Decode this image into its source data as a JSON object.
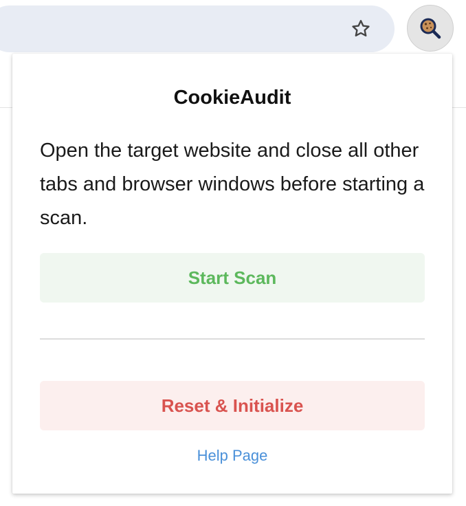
{
  "browser": {
    "bookmark_icon": "star-outline-icon",
    "extension_icon": "cookie-magnifier-icon"
  },
  "popup": {
    "title": "CookieAudit",
    "instructions": "Open the target website and close all other tabs and browser windows before starting a scan.",
    "start_scan_label": "Start Scan",
    "reset_label": "Reset & Initialize",
    "help_label": "Help Page"
  },
  "colors": {
    "start_scan_text": "#5cb85c",
    "start_scan_bg": "#f0f7f0",
    "reset_text": "#d9534f",
    "reset_bg": "#fcefee",
    "link": "#4a90d9"
  }
}
